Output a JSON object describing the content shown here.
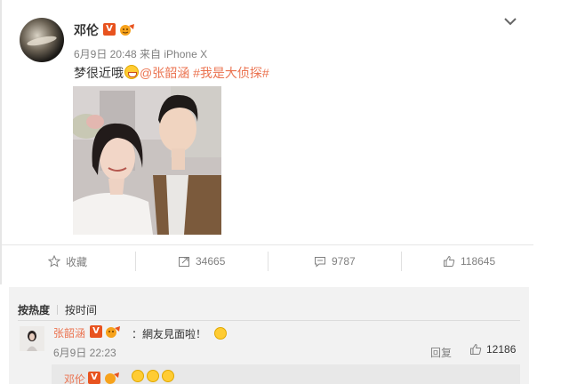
{
  "post": {
    "author": "邓伦",
    "meta": "6月9日 20:48 来自 iPhone X",
    "text_main": "梦很近哦",
    "mention": "@张韶涵",
    "hashtag": "#我是大侦探#"
  },
  "actions": {
    "favorite": "收藏",
    "repost_count": "34665",
    "comment_count": "9787",
    "like_count": "118645"
  },
  "comments": {
    "tab_hot": "按热度",
    "tab_time": "按时间",
    "items": [
      {
        "author": "张韶涵",
        "text": "：網友見面啦！",
        "time": "6月9日 22:23",
        "reply_label": "回复",
        "likes": "12186"
      }
    ],
    "sub_reply": {
      "author": "邓伦"
    }
  },
  "colors": {
    "link": "#eb7350",
    "verified": "#e8531f",
    "muted": "#808080"
  }
}
